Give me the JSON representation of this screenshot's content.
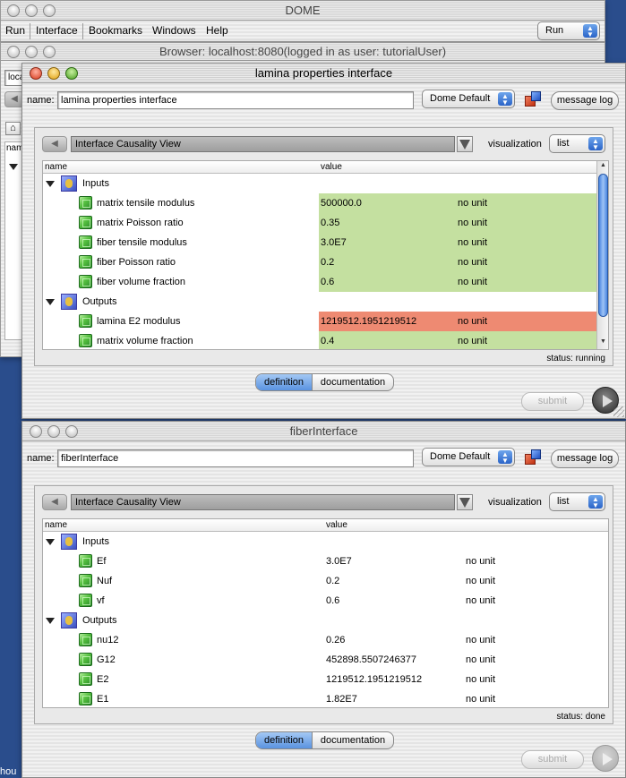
{
  "app": {
    "window_title": "DOME",
    "menu": [
      "Run",
      "Interface",
      "Bookmarks",
      "Windows",
      "Help"
    ],
    "run_select": "Run"
  },
  "browser": {
    "title": "Browser: localhost:8080(logged in as user: tutorialUser)",
    "location_fragment": "loca",
    "name_col_fragment": "nam"
  },
  "lamina": {
    "window_title": "lamina properties interface",
    "name_label": "name:",
    "name_value": "lamina properties interface",
    "mode_select": "Dome Default",
    "message_log": "message log",
    "view_select": "Interface Causality View",
    "visualization_label": "visualization",
    "visualization_select": "list",
    "columns": {
      "name": "name",
      "value": "value"
    },
    "inputs_label": "Inputs",
    "outputs_label": "Outputs",
    "inputs": [
      {
        "name": "matrix tensile modulus",
        "value": "500000.0",
        "unit": "no unit"
      },
      {
        "name": "matrix Poisson ratio",
        "value": "0.35",
        "unit": "no unit"
      },
      {
        "name": "fiber tensile modulus",
        "value": "3.0E7",
        "unit": "no unit"
      },
      {
        "name": "fiber Poisson ratio",
        "value": "0.2",
        "unit": "no unit"
      },
      {
        "name": "fiber volume fraction",
        "value": "0.6",
        "unit": "no unit"
      }
    ],
    "outputs": [
      {
        "name": "lamina E2 modulus",
        "value": "1219512.1951219512",
        "unit": "no unit"
      },
      {
        "name": "matrix volume fraction",
        "value": "0.4",
        "unit": "no unit"
      }
    ],
    "status": "status: running",
    "tab_definition": "definition",
    "tab_documentation": "documentation",
    "submit": "submit",
    "colors": {
      "input_cell": "#c4e0a0",
      "changed_cell": "#ee8a72"
    }
  },
  "fiber": {
    "window_title": "fiberInterface",
    "name_label": "name:",
    "name_value": "fiberInterface",
    "mode_select": "Dome Default",
    "message_log": "message log",
    "view_select": "Interface Causality View",
    "visualization_label": "visualization",
    "visualization_select": "list",
    "columns": {
      "name": "name",
      "value": "value"
    },
    "inputs_label": "Inputs",
    "outputs_label": "Outputs",
    "inputs": [
      {
        "name": "Ef",
        "value": "3.0E7",
        "unit": "no unit"
      },
      {
        "name": "Nuf",
        "value": "0.2",
        "unit": "no unit"
      },
      {
        "name": "vf",
        "value": "0.6",
        "unit": "no unit"
      }
    ],
    "outputs": [
      {
        "name": "nu12",
        "value": "0.26",
        "unit": "no unit"
      },
      {
        "name": "G12",
        "value": "452898.5507246377",
        "unit": "no unit"
      },
      {
        "name": "E2",
        "value": "1219512.1951219512",
        "unit": "no unit"
      },
      {
        "name": "E1",
        "value": "1.82E7",
        "unit": "no unit"
      }
    ],
    "status": "status: done",
    "tab_definition": "definition",
    "tab_documentation": "documentation",
    "submit": "submit"
  },
  "desktop": {
    "corner_fragment": "hou"
  }
}
